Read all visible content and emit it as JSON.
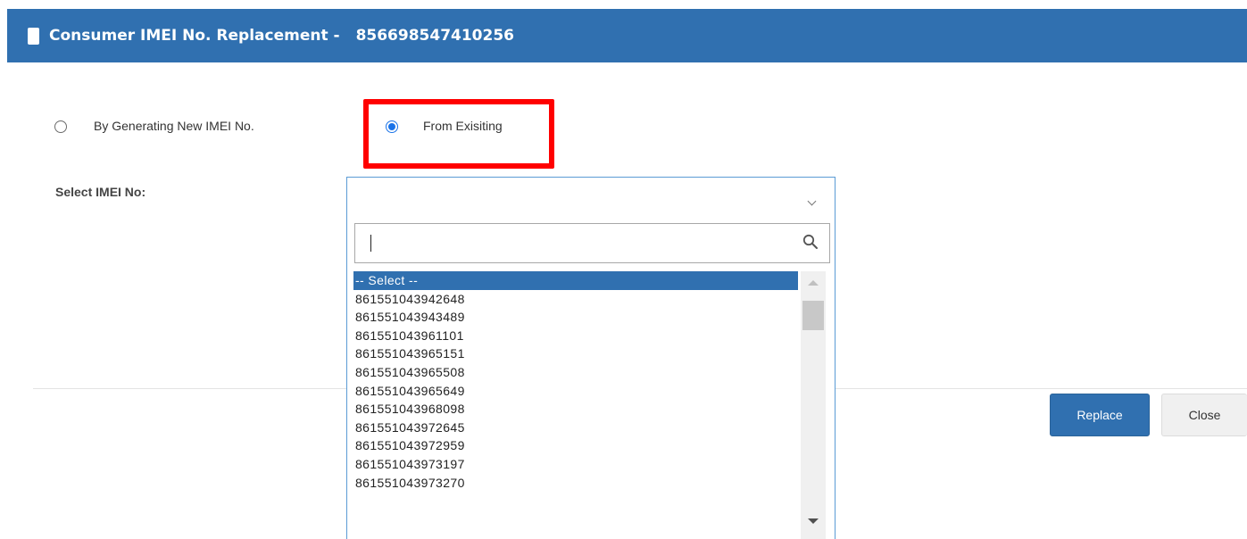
{
  "dialog": {
    "title": "Consumer IMEI No. Replacement -",
    "imei": "856698547410256"
  },
  "radios": {
    "generate_label": "By Generating New IMEI No.",
    "existing_label": "From Exisiting",
    "selected": "existing"
  },
  "select": {
    "label": "Select IMEI No:",
    "search_value": "",
    "options": [
      "-- Select --",
      "861551043942648",
      "861551043943489",
      "861551043961101",
      "861551043965151",
      "861551043965508",
      "861551043965649",
      "861551043968098",
      "861551043972645",
      "861551043972959",
      "861551043973197",
      "861551043973270"
    ],
    "selected_index": 0
  },
  "buttons": {
    "replace": "Replace",
    "close": "Close"
  },
  "colors": {
    "header_bg": "#3070b0",
    "highlight": "#ff0000",
    "selected_option_bg": "#3070b0"
  }
}
